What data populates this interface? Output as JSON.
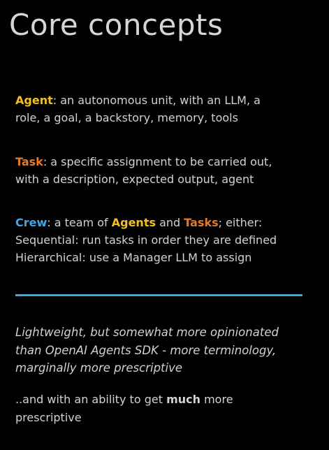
{
  "title": "Core concepts",
  "agent": {
    "term": "Agent",
    "line1": ": an autonomous unit, with an LLM, a",
    "line2": "role, a goal, a backstory, memory, tools"
  },
  "task": {
    "term": "Task",
    "line1": ": a specific assignment to be carried out,",
    "line2": "with a description, expected output, agent"
  },
  "crew": {
    "term": "Crew",
    "text_a": ": a team of ",
    "agents_term": "Agents",
    "text_b": " and ",
    "tasks_term": "Tasks",
    "text_c": "; either:",
    "line2": "Sequential: run tasks in order they are defined",
    "line3": "Hierarchical: use a Manager LLM to assign"
  },
  "note": {
    "line1": "Lightweight, but somewhat more opinionated",
    "line2": "than OpenAI Agents SDK - more terminology,",
    "line3": "marginally more prescriptive"
  },
  "closing": {
    "text_a": "..and with an ability to get ",
    "emphasis": "much",
    "text_b": " more",
    "line2": "prescriptive"
  },
  "colors": {
    "agent": "#f2c01e",
    "task": "#e57a2b",
    "crew": "#3ea6ea",
    "background": "#000000"
  }
}
